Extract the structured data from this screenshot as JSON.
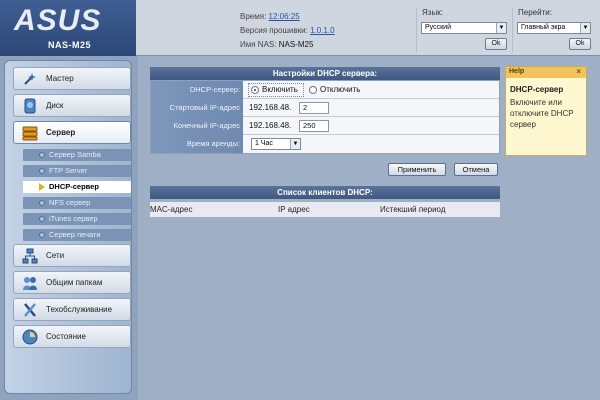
{
  "header": {
    "logo": "ASUS",
    "model": "NAS-M25",
    "time_label": "Время:",
    "time_value": "12:06:25",
    "firmware_label": "Версия прошивки:",
    "firmware_value": "1.0.1.0",
    "nas_name_label": "Имя NAS:",
    "nas_name_value": "NAS-M25",
    "language_label": "Язык:",
    "language_value": "Русский",
    "goto_label": "Перейти:",
    "goto_value": "Главный экра",
    "ok_label": "Ok"
  },
  "sidebar": {
    "items": [
      {
        "label": "Мастер",
        "icon": "wizard-icon"
      },
      {
        "label": "Диск",
        "icon": "disk-icon"
      },
      {
        "label": "Сервер",
        "icon": "server-icon"
      },
      {
        "label": "Сети",
        "icon": "network-icon"
      },
      {
        "label": "Общим папкам",
        "icon": "shared-folders-icon"
      },
      {
        "label": "Техобслуживание",
        "icon": "maintenance-icon"
      },
      {
        "label": "Состояние",
        "icon": "status-icon"
      }
    ],
    "subitems": [
      {
        "label": "Сервер Samba"
      },
      {
        "label": "FTP Server"
      },
      {
        "label": "DHCP-сервер"
      },
      {
        "label": "NFS сервер"
      },
      {
        "label": "iTunes сервер"
      },
      {
        "label": "Сервер печати"
      }
    ]
  },
  "dhcp": {
    "title": "Настройки DHCP сервера:",
    "server_label": "DHCP-сервер:",
    "enable_label": "Включить",
    "disable_label": "Отключить",
    "start_label": "Стартовый IP-адрес",
    "start_prefix": "192.168.48.",
    "start_value": "2",
    "end_label": "Конечный IP-адрес",
    "end_prefix": "192.168.48.",
    "end_value": "250",
    "lease_label": "Время аренды:",
    "lease_value": "1 Час",
    "apply_label": "Применить",
    "cancel_label": "Отмена"
  },
  "clients": {
    "title": "Список клиентов DHCP:",
    "columns": [
      "MAC-адрес",
      "IP адрес",
      "Истекший период"
    ]
  },
  "help": {
    "title": "Help",
    "close": "×",
    "heading": "DHCP-сервер",
    "body": "Включите или отключите DHCP сервер"
  }
}
